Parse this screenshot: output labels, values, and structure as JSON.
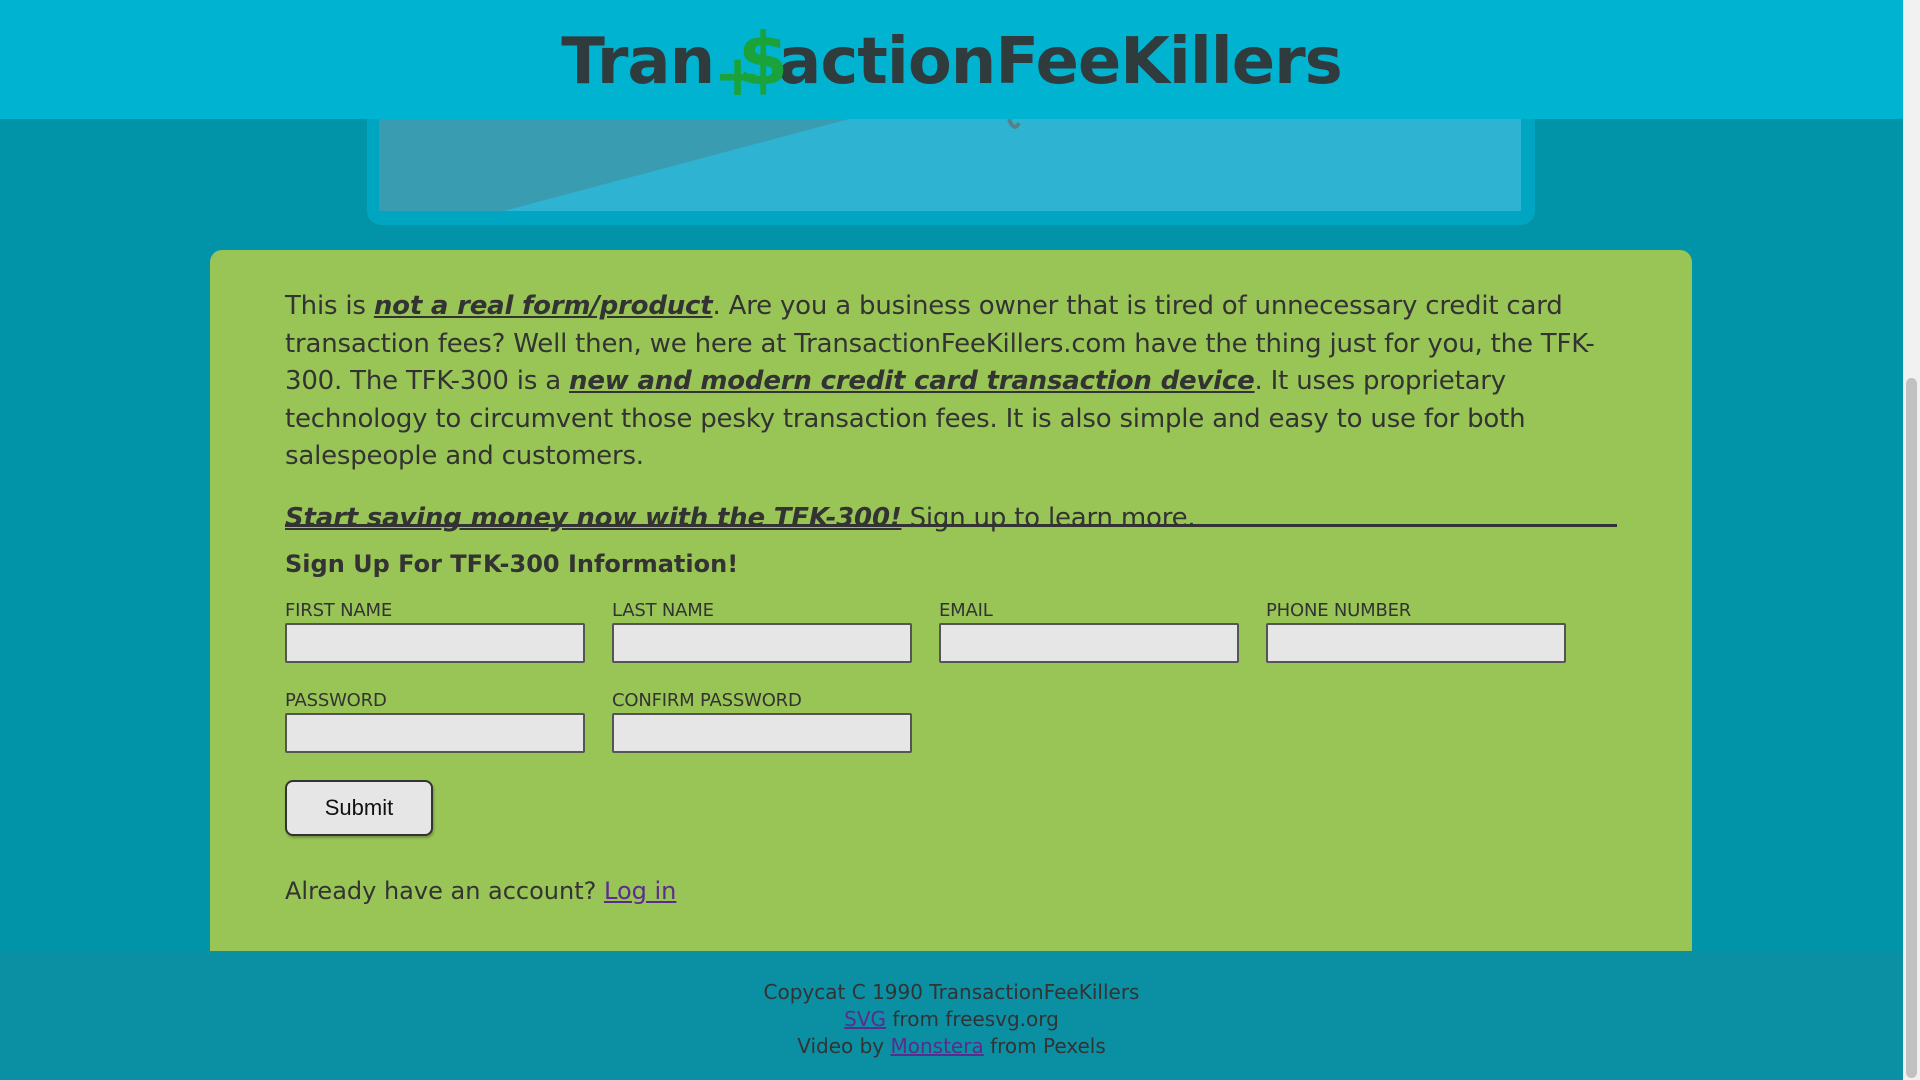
{
  "header": {
    "logo_left": "Tran",
    "logo_plus": "+",
    "logo_dollar": "$",
    "logo_right": "actionFeeKillers"
  },
  "intro": {
    "p1_a": "This is ",
    "p1_em1": "not a real form/product",
    "p1_b": ". Are you a business owner that is tired of unnecessary credit card transaction fees? Well then, we here at TransactionFeeKillers.com have the thing just for you, the TFK-300. The TFK-300 is a ",
    "p1_em2": "new and modern credit card transaction device",
    "p1_c": ". It uses proprietary technology to circumvent those pesky transaction fees. It is also simple and easy to use for both salespeople and customers.",
    "cta_em": "Start saving money now with the TFK-300!",
    "cta_rest": " Sign up to learn more."
  },
  "form": {
    "title": "Sign Up For TFK-300 Information!",
    "first_name_label": "FIRST NAME",
    "first_name_value": "",
    "last_name_label": "LAST NAME",
    "last_name_value": "",
    "email_label": "EMAIL",
    "email_value": "",
    "phone_label": "PHONE NUMBER",
    "phone_value": "",
    "password_label": "PASSWORD",
    "password_value": "",
    "confirm_password_label": "CONFIRM PASSWORD",
    "confirm_password_value": "",
    "submit_label": "Submit",
    "login_prompt": "Already have an account? ",
    "login_link": "Log in"
  },
  "footer": {
    "copyright": "Copycat C 1990 TransactionFeeKillers",
    "svg_link": "SVG",
    "svg_rest": " from freesvg.org",
    "video_prefix": "Video by ",
    "video_link": "Monstera",
    "video_rest": " from Pexels"
  },
  "colors": {
    "header_bg": "#00b3d0",
    "page_bg": "#0193a8",
    "card_bg": "#99c556",
    "logo_accent": "#1aa33a",
    "link": "#5b2c8f"
  }
}
